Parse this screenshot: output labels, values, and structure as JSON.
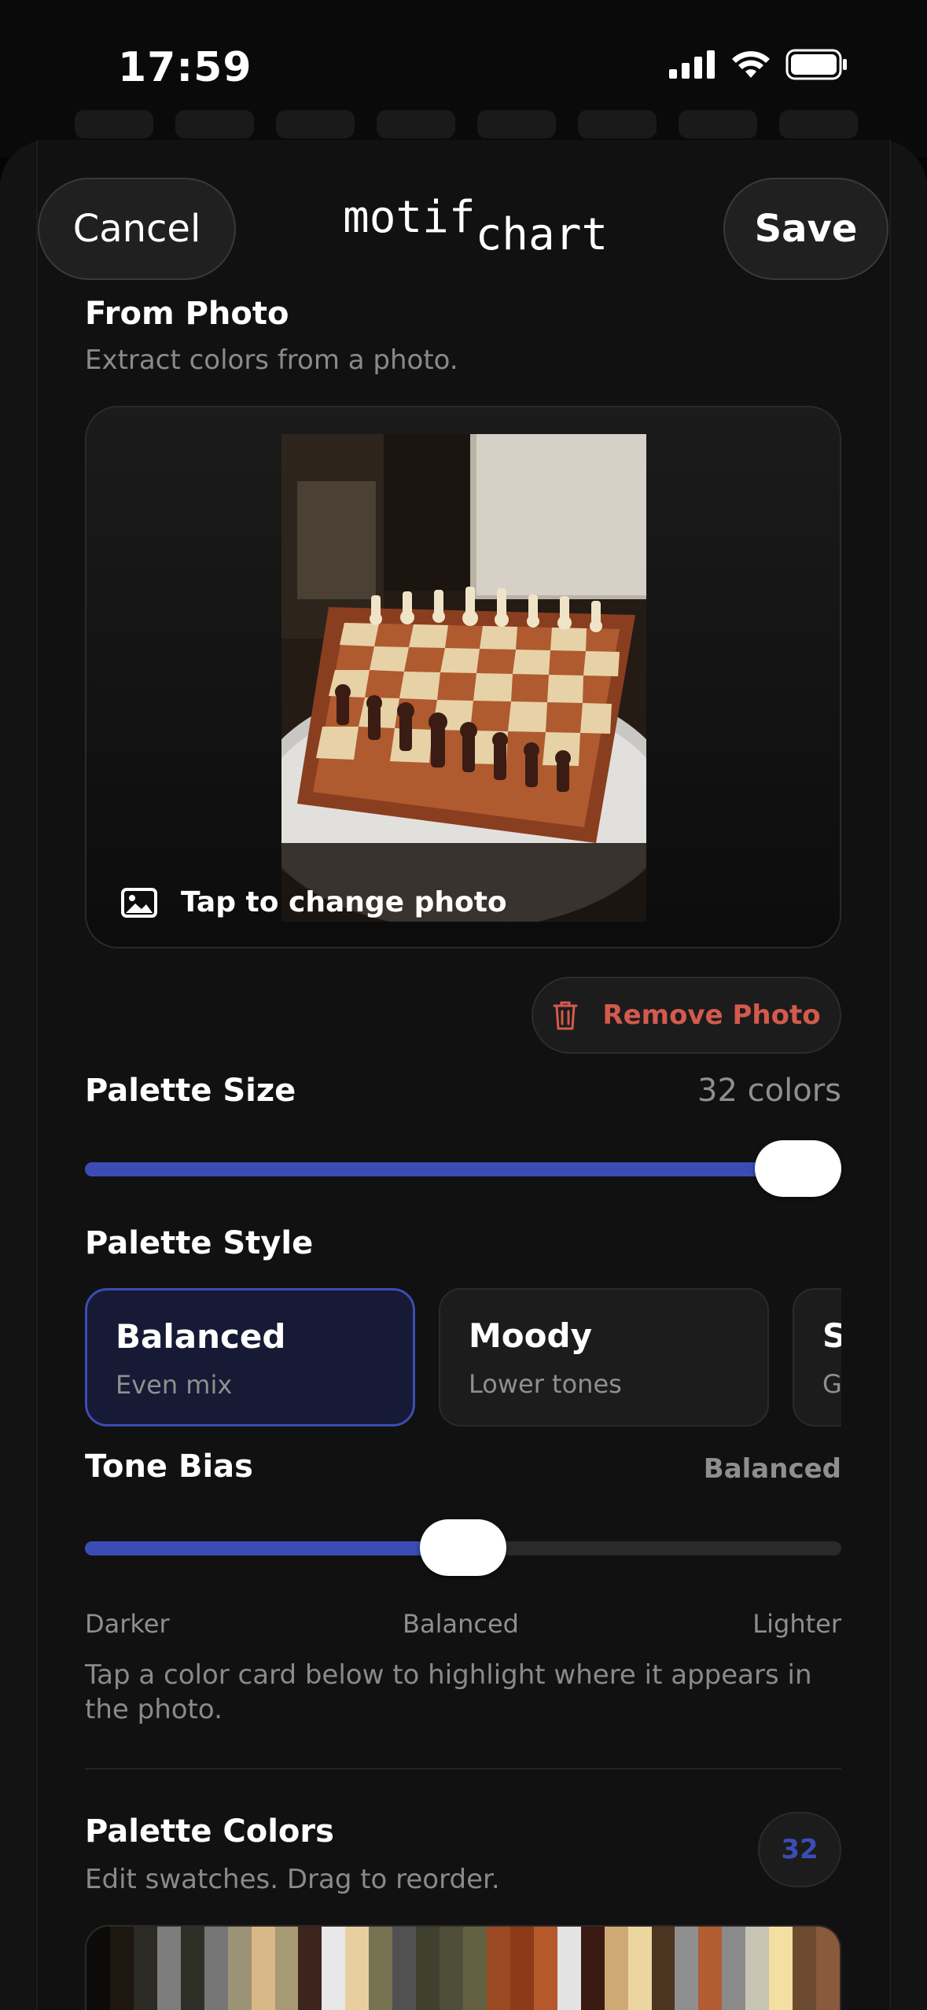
{
  "status": {
    "time": "17:59"
  },
  "nav": {
    "cancel": "Cancel",
    "save": "Save",
    "logo_part1": "motif",
    "logo_part2": "chart"
  },
  "from_photo": {
    "title": "From Photo",
    "subtitle": "Extract colors from a photo.",
    "change_label": "Tap to change photo",
    "remove_label": "Remove Photo"
  },
  "palette_size": {
    "label": "Palette Size",
    "value_text": "32 colors",
    "value": 32,
    "max": 32,
    "fraction": 1.0
  },
  "palette_style": {
    "label": "Palette Style",
    "options": [
      {
        "title": "Balanced",
        "subtitle": "Even mix",
        "selected": true
      },
      {
        "title": "Moody",
        "subtitle": "Lower tones",
        "selected": false
      },
      {
        "title": "S",
        "subtitle": "G",
        "selected": false
      }
    ]
  },
  "tone_bias": {
    "label": "Tone Bias",
    "value_text": "Balanced",
    "fraction": 0.5,
    "ticks": [
      "Darker",
      "Balanced",
      "Lighter"
    ]
  },
  "hint": "Tap a color card below to highlight where it appears in the photo.",
  "palette_colors": {
    "title": "Palette Colors",
    "subtitle": "Edit swatches. Drag to reorder.",
    "count": "32",
    "swatches": [
      "#0d0b09",
      "#1d1710",
      "#2b2a24",
      "#7d7d7d",
      "#2f2f27",
      "#767676",
      "#9c9276",
      "#d8b886",
      "#a99a76",
      "#3d241c",
      "#e7e7e7",
      "#e9cfa0",
      "#767252",
      "#515151",
      "#40402f",
      "#4f4f39",
      "#646042",
      "#9a4a22",
      "#8c3a18",
      "#b5582c",
      "#e3e3e3",
      "#3a1a12",
      "#cfa974",
      "#ecd59e",
      "#4b3420",
      "#8f8f8f",
      "#b25c34",
      "#8a8a8a",
      "#c8c4b4",
      "#f3dfa2",
      "#6c4a30",
      "#8a5a3c"
    ]
  },
  "accent_color": "#3b4db5",
  "danger_color": "#d35a4d"
}
